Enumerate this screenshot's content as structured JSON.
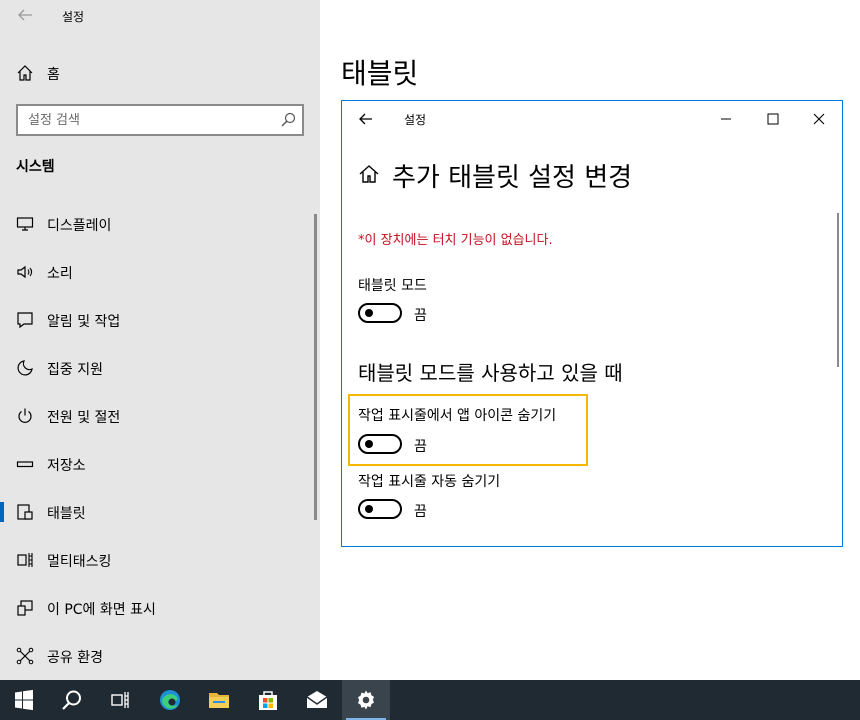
{
  "app": {
    "title": "설정"
  },
  "sidebar": {
    "home_label": "홈",
    "search_placeholder": "설정 검색",
    "section_title": "시스템",
    "items": [
      {
        "label": "디스플레이",
        "icon": "monitor-icon"
      },
      {
        "label": "소리",
        "icon": "speaker-icon"
      },
      {
        "label": "알림 및 작업",
        "icon": "notification-icon"
      },
      {
        "label": "집중 지원",
        "icon": "moon-icon"
      },
      {
        "label": "전원 및 절전",
        "icon": "power-icon"
      },
      {
        "label": "저장소",
        "icon": "storage-icon"
      },
      {
        "label": "태블릿",
        "icon": "tablet-icon",
        "selected": true
      },
      {
        "label": "멀티태스킹",
        "icon": "multitasking-icon"
      },
      {
        "label": "이 PC에 화면 표시",
        "icon": "project-icon"
      },
      {
        "label": "공유 환경",
        "icon": "share-icon"
      }
    ]
  },
  "main": {
    "heading": "태블릿"
  },
  "dialog": {
    "title": "설정",
    "heading": "추가 태블릿 설정 변경",
    "warning": "*이 장치에는 터치 기능이 없습니다.",
    "tablet_mode": {
      "label": "태블릿 모드",
      "state": "끔"
    },
    "subheading": "태블릿 모드를 사용하고 있을 때",
    "hide_icons": {
      "label": "작업 표시줄에서 앱 아이콘 숨기기",
      "state": "끔"
    },
    "auto_hide": {
      "label": "작업 표시줄 자동 숨기기",
      "state": "끔"
    }
  },
  "taskbar": {
    "items": [
      "windows-start-icon",
      "search-icon",
      "task-view-icon",
      "edge-icon",
      "file-explorer-icon",
      "store-icon",
      "mail-icon",
      "settings-icon"
    ],
    "active": "settings-icon"
  },
  "colors": {
    "accent": "#0067c0",
    "highlight": "#f5b800",
    "warning": "#c50f1f",
    "taskbar": "#1f2a33"
  }
}
